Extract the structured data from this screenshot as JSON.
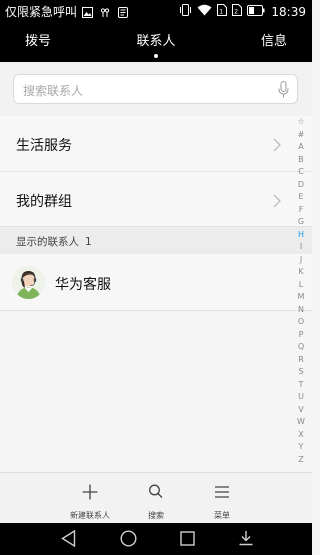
{
  "status_bar": {
    "left_text": "仅限紧急呼叫",
    "time": "18:39",
    "icons": [
      "image-icon",
      "sim-signal-icon",
      "notification-icon",
      "vibrate-icon",
      "wifi-icon",
      "sim-card-icon",
      "sim-card-icon",
      "battery-icon"
    ]
  },
  "tabs": [
    {
      "label": "拨号",
      "active": false
    },
    {
      "label": "联系人",
      "active": true
    },
    {
      "label": "信息",
      "active": false
    }
  ],
  "search": {
    "placeholder": "搜索联系人",
    "icon": "mic-icon"
  },
  "rows": [
    {
      "label": "生活服务",
      "icon": "chevron-right-icon"
    },
    {
      "label": "我的群组",
      "icon": "chevron-right-icon"
    }
  ],
  "section_header": {
    "label": "显示的联系人",
    "count": "1"
  },
  "contacts": [
    {
      "name": "华为客服",
      "avatar": "customer-service-avatar"
    }
  ],
  "alpha_index": [
    "☆",
    "#",
    "A",
    "B",
    "C",
    "D",
    "E",
    "F",
    "G",
    "H",
    "I",
    "J",
    "K",
    "L",
    "M",
    "N",
    "O",
    "P",
    "Q",
    "R",
    "S",
    "T",
    "U",
    "V",
    "W",
    "X",
    "Y",
    "Z"
  ],
  "alpha_active": "H",
  "bottom_actions": [
    {
      "label": "新建联系人",
      "icon": "plus-icon"
    },
    {
      "label": "搜索",
      "icon": "search-icon"
    },
    {
      "label": "菜单",
      "icon": "menu-icon"
    }
  ],
  "nav_bar": {
    "icons": [
      "back-icon",
      "home-icon",
      "recents-icon",
      "notification-pull-icon"
    ]
  },
  "colors": {
    "accent": "#1c9be0",
    "bar_background": "#000000",
    "page_background": "#f5f5f5"
  }
}
